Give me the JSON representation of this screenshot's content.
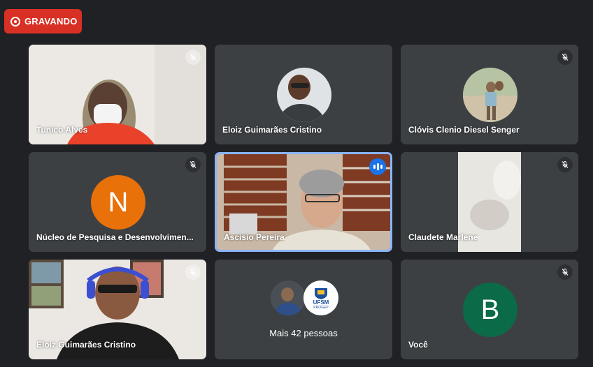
{
  "recording": {
    "label": "GRAVANDO"
  },
  "tiles": [
    {
      "name": "Tunico Alves"
    },
    {
      "name": "Eloiz Guimarães Cristino"
    },
    {
      "name": "Clóvis Clenio Diesel Senger"
    },
    {
      "name": "Núcleo de Pesquisa e Desenvolvimen...",
      "initial": "N",
      "avatar_color": "#e8710a"
    },
    {
      "name": "Ascisio Pereira"
    },
    {
      "name": "Claudete Marlene"
    },
    {
      "name": "Eloiz Guimarães Cristino"
    },
    {
      "more_label": "Mais 42 pessoas",
      "logo_text": "UFSM",
      "logo_subtext": "PROGEP"
    },
    {
      "name": "Você",
      "initial": "B",
      "avatar_color": "#0b6a47"
    }
  ],
  "colors": {
    "background": "#202124",
    "tile": "#3c4043",
    "record": "#d93025",
    "active_border": "#8ab4f8"
  },
  "icons": {
    "muted": "mic-off-icon",
    "speaking": "audio-level-icon",
    "record": "record-icon"
  }
}
